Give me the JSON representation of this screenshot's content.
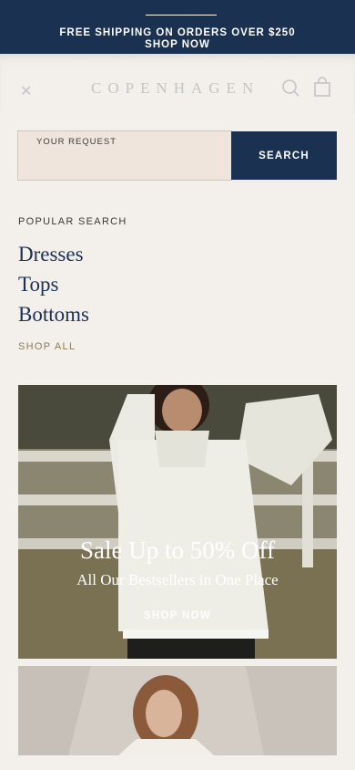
{
  "announcement": {
    "line1": "FREE SHIPPING ON ORDERS OVER $250",
    "line2": "SHOP NOW"
  },
  "header": {
    "menu_icon": "menu-icon",
    "logo": "COPENHAGEN",
    "search_icon": "search-icon",
    "bag_icon": "bag-icon"
  },
  "search": {
    "label": "YOUR REQUEST",
    "value": "",
    "button": "SEARCH"
  },
  "popular": {
    "title": "POPULAR SEARCH",
    "items": [
      "Dresses",
      "Tops",
      "Bottoms"
    ],
    "shop_all": "SHOP ALL"
  },
  "promo": {
    "headline": "Sale Up to 50% Off",
    "subheadline": "All Our Bestsellers in One Place",
    "cta": "SHOP NOW"
  },
  "colors": {
    "navy": "#1a3152",
    "background": "#f3efea",
    "input_bg": "#efe5dd",
    "gold": "#8e7c53"
  }
}
